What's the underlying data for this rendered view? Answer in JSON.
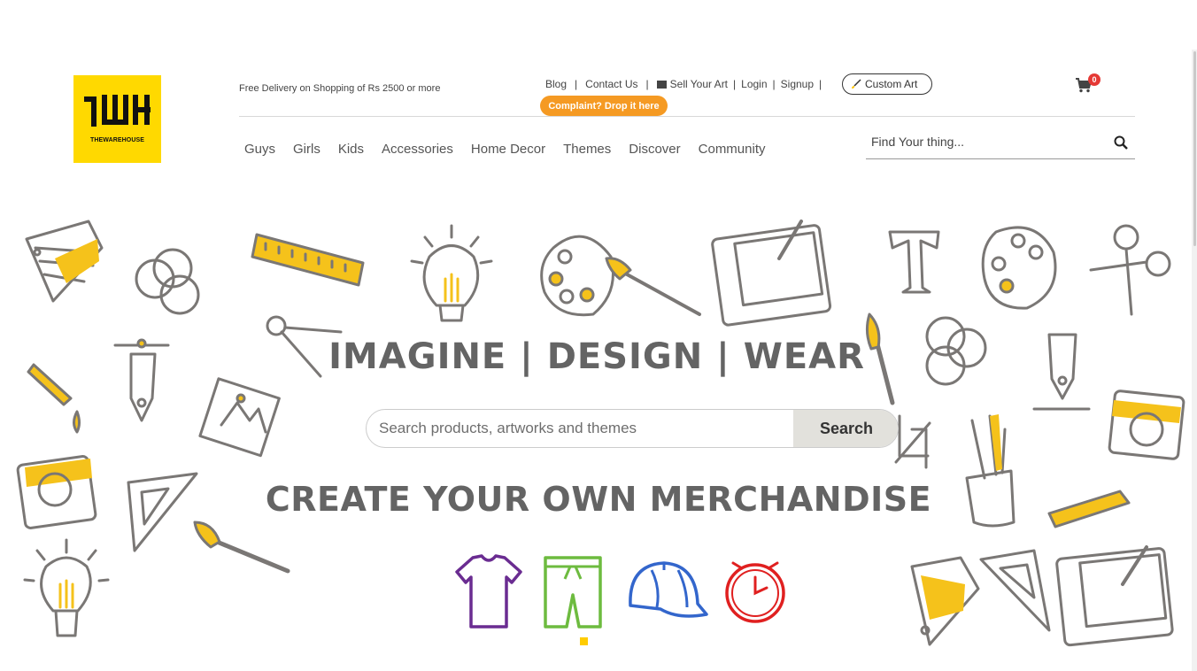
{
  "header": {
    "logo_text": "THEWAREHOUSE",
    "free_delivery": "Free Delivery on Shopping of Rs 2500 or more",
    "links": {
      "blog": "Blog",
      "contact": "Contact Us",
      "sell": "Sell Your Art",
      "login": "Login",
      "signup": "Signup",
      "custom_art": "Custom Art"
    },
    "separator": "|",
    "complaint": "Complaint? Drop it here",
    "cart_count": "0",
    "nav": [
      "Guys",
      "Girls",
      "Kids",
      "Accessories",
      "Home Decor",
      "Themes",
      "Discover",
      "Community"
    ],
    "search_placeholder": "Find Your thing..."
  },
  "hero": {
    "tagline": "IMAGINE | DESIGN | WEAR",
    "search_placeholder": "Search products, artworks and themes",
    "search_button": "Search",
    "subtitle": "CREATE YOUR OWN MERCHANDISE",
    "merch_icons": [
      "tshirt-icon",
      "shorts-icon",
      "cap-icon",
      "clock-icon"
    ],
    "colors": {
      "tshirt": "#6a2c91",
      "shorts": "#6dbb3f",
      "cap": "#3366cc",
      "clock": "#e02020",
      "accent": "#ffd900",
      "complaint": "#f59a23"
    }
  }
}
